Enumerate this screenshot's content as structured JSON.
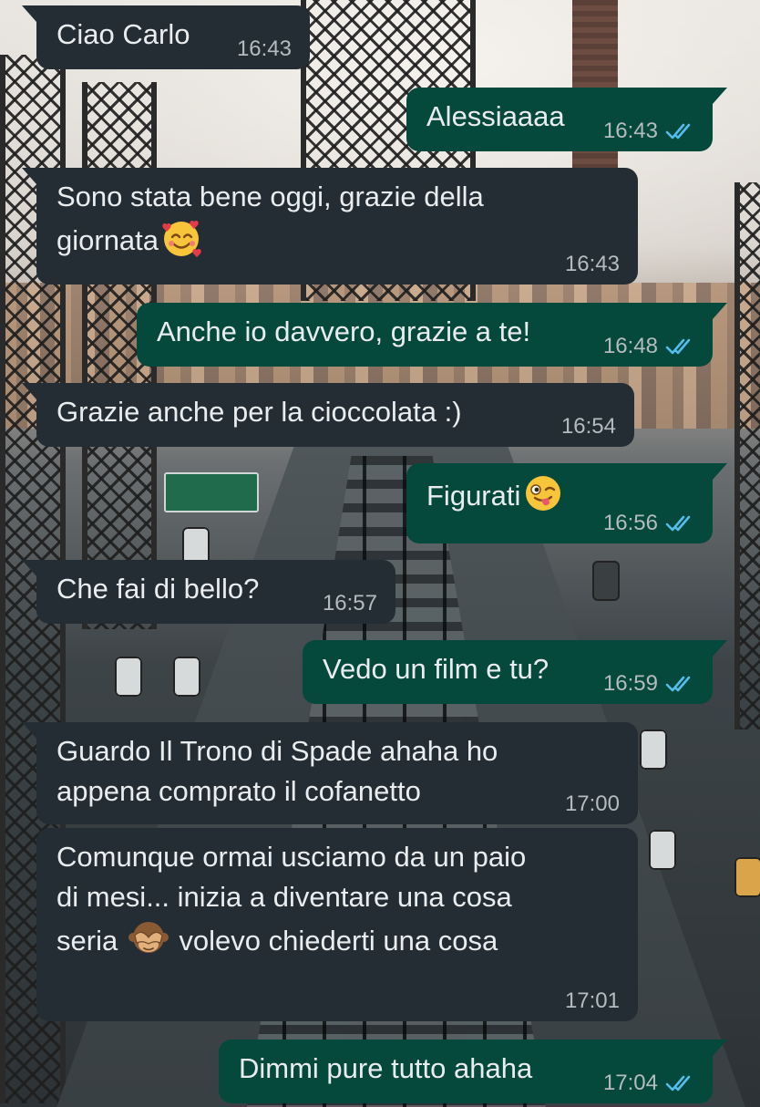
{
  "chat": {
    "messages": [
      {
        "dir": "in",
        "text": "Ciao Carlo",
        "time": "16:43"
      },
      {
        "dir": "out",
        "text": "Alessiaaaa",
        "time": "16:43",
        "status": "read"
      },
      {
        "dir": "in",
        "text_before": "Sono stata bene oggi, grazie della\ngiornata",
        "emoji": "smiling-face-with-hearts",
        "time": "16:43"
      },
      {
        "dir": "out",
        "text": "Anche io davvero, grazie a te!",
        "time": "16:48",
        "status": "read"
      },
      {
        "dir": "in",
        "text": "Grazie anche per la cioccolata :)",
        "time": "16:54"
      },
      {
        "dir": "out",
        "text": "Figurati",
        "emoji": "winking-face-with-tongue",
        "time": "16:56",
        "status": "read"
      },
      {
        "dir": "in",
        "text": "Che fai di bello?",
        "time": "16:57"
      },
      {
        "dir": "out",
        "text": "Vedo un film e tu?",
        "time": "16:59",
        "status": "read"
      },
      {
        "dir": "in",
        "text": "Guardo Il Trono di Spade ahaha ho\nappena comprato il cofanetto",
        "time": "17:00"
      },
      {
        "dir": "in",
        "text_before": "Comunque ormai usciamo da un paio\ndi mesi... inizia a diventare una cosa\nseria ",
        "emoji": "see-no-evil-monkey",
        "text_after": " volevo chiederti una cosa",
        "time": "17:01"
      },
      {
        "dir": "out",
        "text": "Dimmi pure tutto ahaha",
        "time": "17:04",
        "status": "read"
      }
    ]
  },
  "colors": {
    "incoming_bubble": "#232d33",
    "outgoing_bubble": "#05483c",
    "text": "#e9edef",
    "meta": "#b4bcc0",
    "read_ticks": "#53bdeb"
  }
}
